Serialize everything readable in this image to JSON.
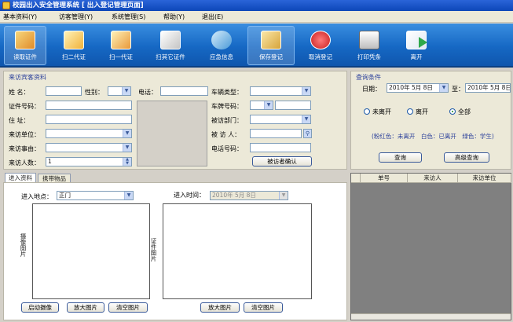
{
  "window": {
    "title": "校园出入安全管理系统 [ 出入登记管理页面]"
  },
  "menu": [
    "基本资料(Y)",
    "访客管理(Y)",
    "系统管理(S)",
    "帮助(Y)",
    "退出(E)"
  ],
  "toolbar": {
    "items": [
      {
        "label": "读取证件",
        "icon": "id-card-icon",
        "color": "#e9a33a"
      },
      {
        "label": "扫二代证",
        "icon": "scan-id2-icon",
        "color": "#f0c64a"
      },
      {
        "label": "扫一代证",
        "icon": "scan-id1-icon",
        "color": "#e8b84a"
      },
      {
        "label": "扫其它证件",
        "icon": "scan-other-icon",
        "color": "#d9d9d9"
      },
      {
        "label": "应急信息",
        "icon": "emergency-info-icon",
        "color": "#7fc0e8"
      },
      {
        "label": "保存登记",
        "icon": "save-register-icon",
        "color": "#f2d58a"
      },
      {
        "label": "取消登记",
        "icon": "cancel-register-icon",
        "color": "#e04040"
      },
      {
        "label": "打印凭条",
        "icon": "printer-icon",
        "color": "#e8e8e8"
      },
      {
        "label": "离开",
        "icon": "exit-icon",
        "color": "#42b24a"
      }
    ]
  },
  "visitor": {
    "section_title": "来访宾客资料",
    "name_label": "姓 名：",
    "gender_label": "性别：",
    "phone_label": "电话：",
    "idno_label": "证件号码：",
    "address_label": "住 址：",
    "unit_label": "来访单位：",
    "reason_label": "来访事由：",
    "count_label": "来访人数：",
    "count_value": "1",
    "vehicle_type_label": "车辆类型：",
    "plate_label": "车牌号码：",
    "dept_label": "被访部门：",
    "visited_label": "被 访 人：",
    "visited_phone_label": "电话号码：",
    "confirm_button": "被访者确认"
  },
  "query": {
    "section_title": "查询条件",
    "date_label": "日期：",
    "date_from": "2010年 5月 8日",
    "to_label": "至：",
    "date_to": "2010年 5月 8日",
    "radios": [
      {
        "label": "未离开",
        "checked": false
      },
      {
        "label": "离开",
        "checked": false
      },
      {
        "label": "全部",
        "checked": true
      }
    ],
    "legend": "(粉红色：未离开　白色：已离开　绿色：学生)",
    "query_button": "查询",
    "advanced_button": "高级查询"
  },
  "tabs": [
    {
      "label": "进入资料",
      "active": true
    },
    {
      "label": "携带物品",
      "active": false
    }
  ],
  "entry": {
    "location_label": "进入地点：",
    "location_value": "正门",
    "time_label": "进入时间：",
    "time_value": "2010年 5月 8日",
    "camera_caption": "摄像图片",
    "cert_caption": "证件图片",
    "start_camera_button": "启动摄像",
    "zoom_button": "放大图片",
    "clear_button": "清空图片",
    "zoom_button2": "放大图片",
    "clear_button2": "清空图片"
  },
  "results": {
    "columns": [
      "单号",
      "来访人",
      "来访单位"
    ]
  }
}
